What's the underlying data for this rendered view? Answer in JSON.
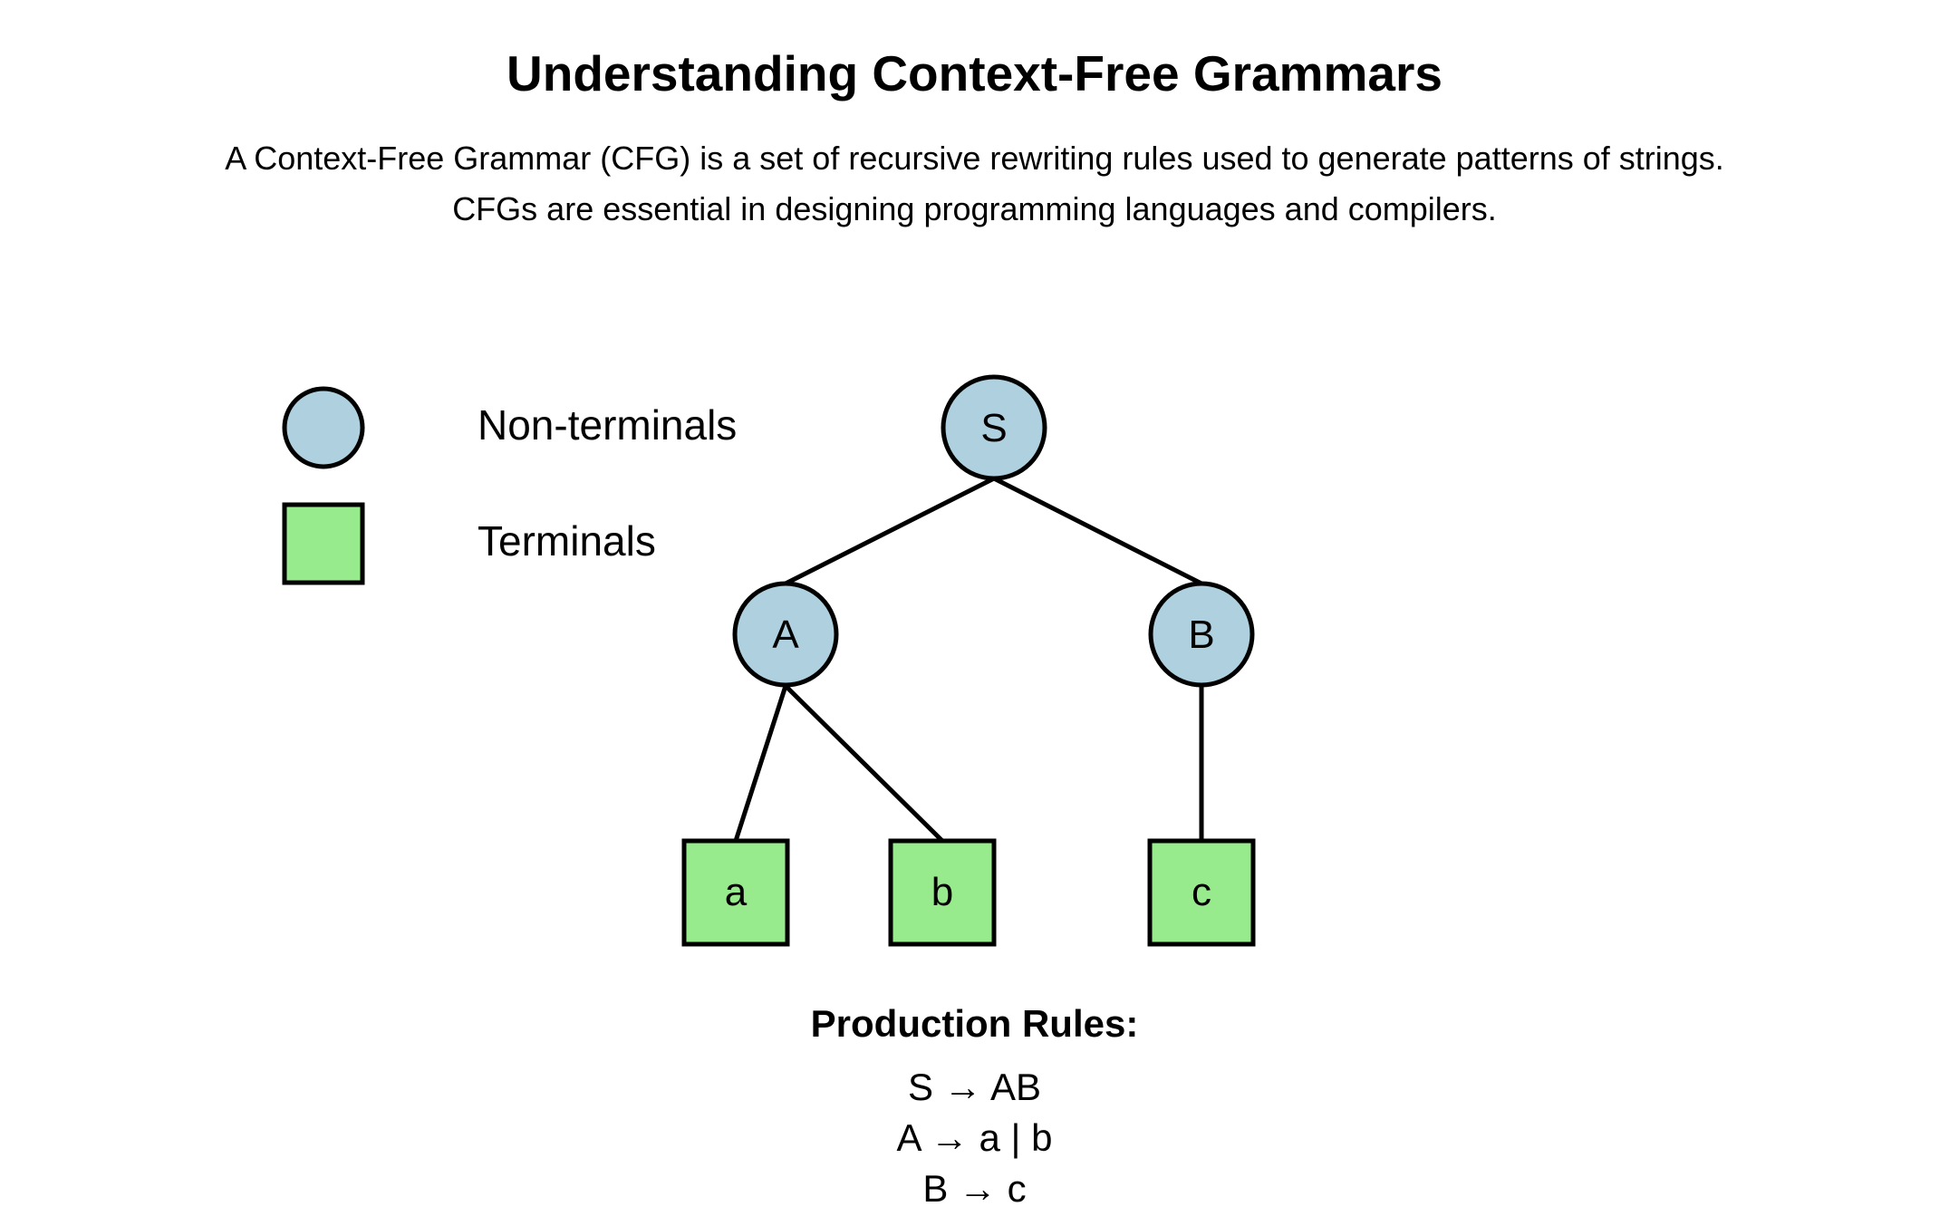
{
  "header": {
    "title": "Understanding Context-Free Grammars",
    "description_line1": "A Context-Free Grammar (CFG) is a set of recursive rewriting rules used to generate patterns of strings.",
    "description_line2": "CFGs are essential in designing programming languages and compilers."
  },
  "legend": {
    "nonterminal_label": "Non-terminals",
    "terminal_label": "Terminals"
  },
  "tree": {
    "nodes": {
      "S": "S",
      "A": "A",
      "B": "B",
      "a": "a",
      "b": "b",
      "c": "c"
    },
    "edges": [
      [
        "S",
        "A"
      ],
      [
        "S",
        "B"
      ],
      [
        "A",
        "a"
      ],
      [
        "A",
        "b"
      ],
      [
        "B",
        "c"
      ]
    ]
  },
  "rules": {
    "title": "Production Rules:",
    "items": [
      "S → AB",
      "A → a | b",
      "B → c"
    ]
  },
  "colors": {
    "nonterminal_fill": "#aed0df",
    "terminal_fill": "#98eb8c",
    "stroke": "#000000"
  }
}
